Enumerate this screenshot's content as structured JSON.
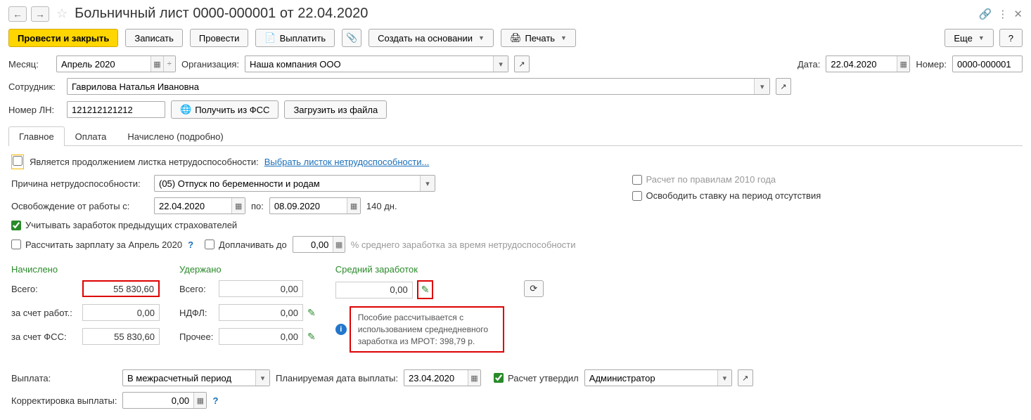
{
  "title": "Больничный лист 0000-000001 от 22.04.2020",
  "toolbar": {
    "post_close": "Провести и закрыть",
    "write": "Записать",
    "post": "Провести",
    "pay": "Выплатить",
    "create_based": "Создать на основании",
    "print": "Печать",
    "more": "Еще",
    "help": "?"
  },
  "fields": {
    "month_label": "Месяц:",
    "month": "Апрель 2020",
    "org_label": "Организация:",
    "org": "Наша компания ООО",
    "date_label": "Дата:",
    "date": "22.04.2020",
    "number_label": "Номер:",
    "number": "0000-000001",
    "employee_label": "Сотрудник:",
    "employee": "Гаврилова Наталья Ивановна",
    "ln_label": "Номер ЛН:",
    "ln": "121212121212",
    "get_fss": "Получить из ФСС",
    "load_file": "Загрузить из файла"
  },
  "tabs": {
    "main": "Главное",
    "payment": "Оплата",
    "accrued": "Начислено (подробно)"
  },
  "main": {
    "is_continuation": "Является продолжением листка нетрудоспособности:",
    "pick_sheet": "Выбрать листок нетрудоспособности...",
    "reason_label": "Причина нетрудоспособности:",
    "reason": "(05) Отпуск по беременности и родам",
    "absence_label": "Освобождение от работы с:",
    "date_from": "22.04.2020",
    "to_label": "по:",
    "date_to": "08.09.2020",
    "days": "140 дн.",
    "prev_insurers": "Учитывать заработок предыдущих страхователей",
    "calc_salary": "Рассчитать зарплату за Апрель 2020",
    "top_up": "Доплачивать до",
    "top_up_val": "0,00",
    "top_up_hint": "% среднего заработка за время нетрудоспособности",
    "rules2010": "Расчет по правилам 2010 года",
    "free_rate": "Освободить ставку на период отсутствия"
  },
  "summary": {
    "accrued_h": "Начислено",
    "withheld_h": "Удержано",
    "avg_h": "Средний заработок",
    "total_label": "Всего:",
    "total_accrued": "55 830,60",
    "employer_label": "за счет работ.:",
    "employer_val": "0,00",
    "fss_label": "за счет ФСС:",
    "fss_val": "55 830,60",
    "withheld_total": "0,00",
    "ndfl_label": "НДФЛ:",
    "ndfl_val": "0,00",
    "other_label": "Прочее:",
    "other_val": "0,00",
    "avg_val": "0,00",
    "info_text": "Пособие рассчитывается с использованием среднедневного заработка из МРОТ: 398,79 р."
  },
  "footer": {
    "payment_label": "Выплата:",
    "payment_val": "В межрасчетный период",
    "plan_date_label": "Планируемая дата выплаты:",
    "plan_date": "23.04.2020",
    "approved": "Расчет утвердил",
    "approver": "Администратор",
    "correction_label": "Корректировка выплаты:",
    "correction_val": "0,00"
  }
}
